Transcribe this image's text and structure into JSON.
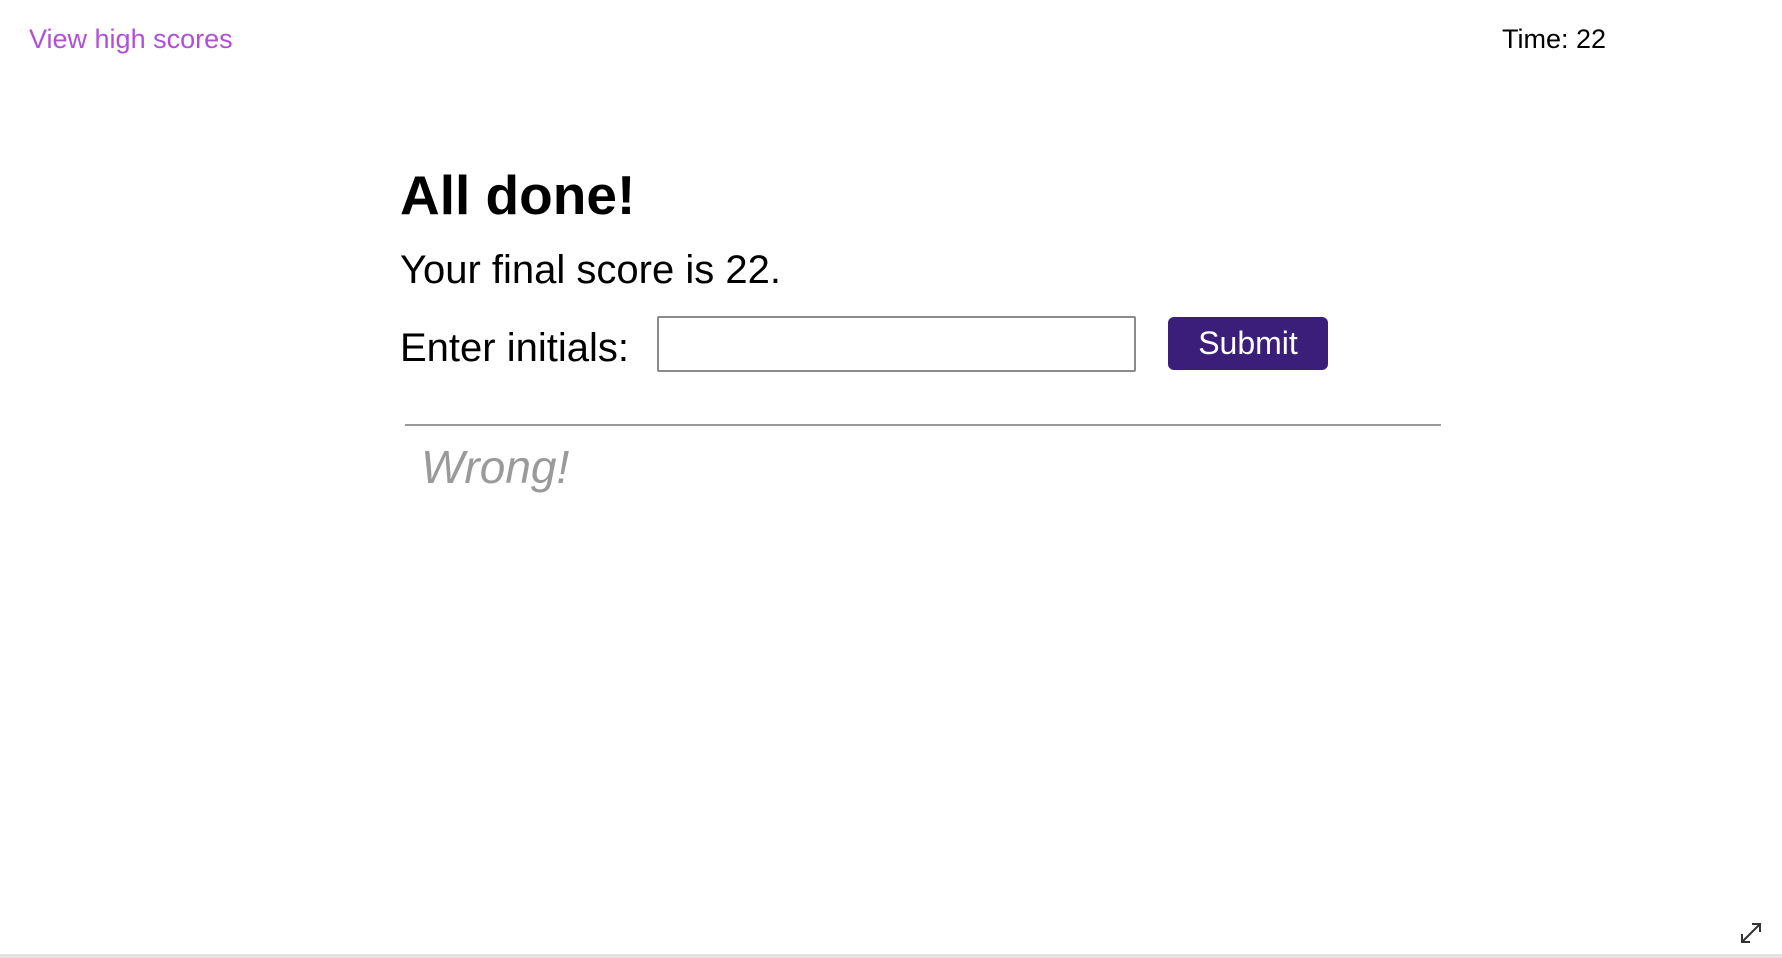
{
  "header": {
    "high_scores_link": "View high scores",
    "timer_label": "Time:",
    "timer_value": "22"
  },
  "main": {
    "title": "All done!",
    "score_prefix": "Your final score is",
    "score_value": "22",
    "score_suffix": ".",
    "initials_label": "Enter initials:",
    "initials_value": "",
    "submit_label": "Submit"
  },
  "feedback": {
    "text": "Wrong!"
  },
  "icons": {
    "expand": "expand-icon"
  },
  "colors": {
    "link": "#b050d8",
    "button": "#3b1d7a",
    "feedback": "#9a9a9a"
  }
}
